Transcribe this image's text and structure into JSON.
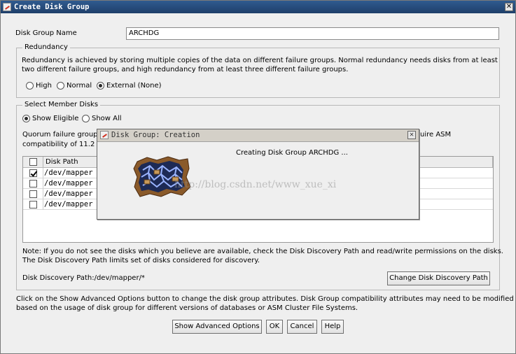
{
  "window": {
    "title": "Create Disk Group",
    "close_glyph": "✕"
  },
  "form": {
    "name_label": "Disk Group Name",
    "name_value": "ARCHDG"
  },
  "redundancy": {
    "legend": "Redundancy",
    "description_line1": "Redundancy is achieved by storing multiple copies of the data on different failure groups. Normal redundancy needs disks from at least",
    "description_line2": "two different failure groups, and high redundancy from at least three different failure groups.",
    "options": [
      {
        "label": "High",
        "selected": false
      },
      {
        "label": "Normal",
        "selected": false
      },
      {
        "label": "External (None)",
        "selected": true
      }
    ]
  },
  "member_disks": {
    "legend": "Select Member Disks",
    "options": [
      {
        "label": "Show Eligible",
        "selected": true
      },
      {
        "label": "Show All",
        "selected": false
      }
    ],
    "quorum_line1_start": "Quorum failure group",
    "quorum_line1_end": "uire ASM",
    "quorum_line2": "compatibility of 11.2 c",
    "table": {
      "column_header": "Disk Path",
      "rows": [
        {
          "path": "/dev/mapper",
          "checked": true
        },
        {
          "path": "/dev/mapper",
          "checked": false
        },
        {
          "path": "/dev/mapper",
          "checked": false
        },
        {
          "path": "/dev/mapper",
          "checked": false
        }
      ]
    },
    "note_line1": "Note: If you do not see the disks which you believe are available, check the Disk Discovery Path and read/write permissions on the disks.",
    "note_line2": "The Disk Discovery Path limits set of disks considered for discovery.",
    "discovery_path_label": "Disk Discovery Path:/dev/mapper/*",
    "change_path_button": "Change Disk Discovery Path"
  },
  "footer": {
    "info_line1": "Click on the Show Advanced Options button to change the disk group attributes. Disk Group compatibility attributes may need to be modified",
    "info_line2": "based on the usage of disk group for different versions of databases or ASM Cluster File Systems.",
    "buttons": {
      "advanced": "Show Advanced Options",
      "ok": "OK",
      "cancel": "Cancel",
      "help": "Help"
    }
  },
  "progress_dialog": {
    "title": "Disk Group: Creation",
    "message": "Creating Disk Group ARCHDG ...",
    "close_glyph": "✕",
    "icon": "disk-group-creation-icon"
  },
  "watermark": "http://blog.csdn.net/www_xue_xi"
}
